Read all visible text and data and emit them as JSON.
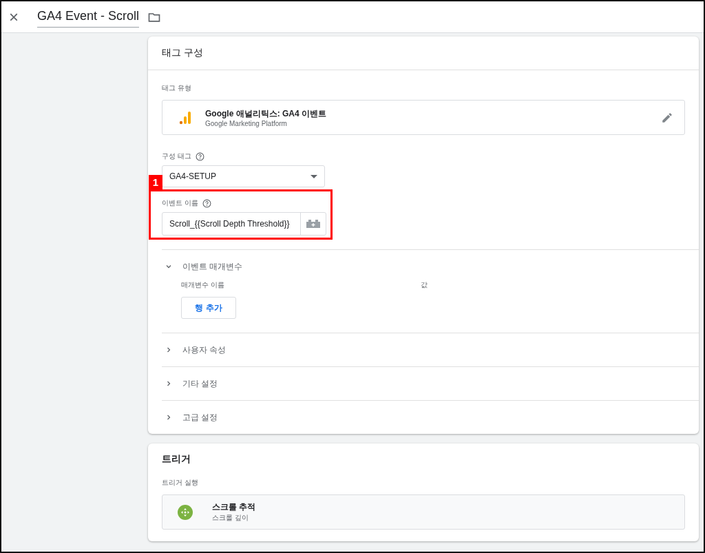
{
  "header": {
    "close": "×",
    "title": "GA4 Event - Scroll"
  },
  "tag_config": {
    "title": "태그 구성",
    "tag_type_label": "태그 유형",
    "tag_type": {
      "name": "Google 애널리틱스: GA4 이벤트",
      "subtitle": "Google Marketing Platform"
    },
    "config_tag": {
      "label": "구성 태그",
      "value": "GA4-SETUP"
    },
    "event_name": {
      "label": "이벤트 이름",
      "value": "Scroll_{{Scroll Depth Threshold}}",
      "annotation": "1"
    },
    "sections": [
      {
        "title": "이벤트 매개변수",
        "expanded": true,
        "columns": [
          "매개변수 이름",
          "값"
        ],
        "button": "행 추가"
      },
      {
        "title": "사용자 속성",
        "expanded": false
      },
      {
        "title": "기타 설정",
        "expanded": false
      },
      {
        "title": "고급 설정",
        "expanded": false
      }
    ]
  },
  "trigger": {
    "title": "트리거",
    "label": "트리거 실행",
    "item": {
      "name": "스크롤 추적",
      "subtitle": "스크롤 깊이"
    }
  }
}
